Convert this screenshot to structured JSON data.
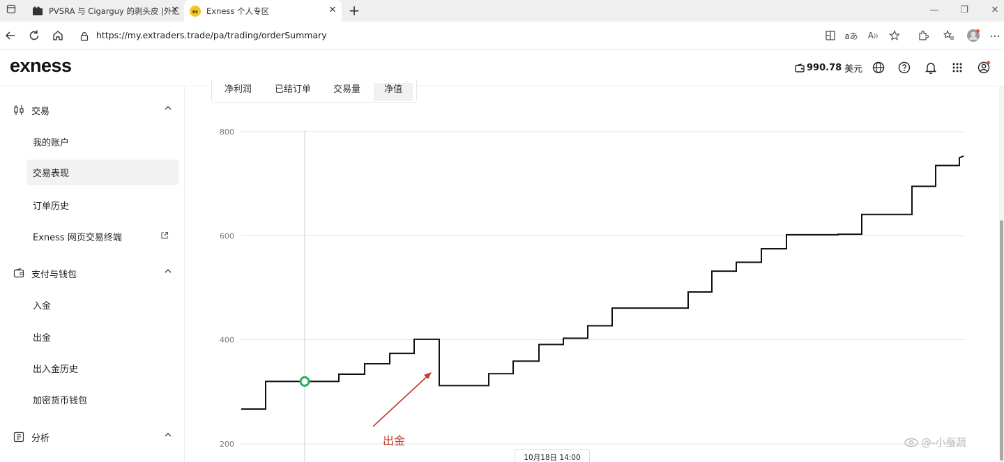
{
  "browser": {
    "tabs": [
      {
        "title": "PVSRA 与 Cigarguy 的剥头皮 |外汇"
      },
      {
        "title": "Exness 个人专区"
      }
    ],
    "url": "https://my.extraders.trade/pa/trading/orderSummary"
  },
  "header": {
    "logo": "exness",
    "balance": "990.78",
    "balance_unit": "美元"
  },
  "sidebar": {
    "sections": [
      {
        "label": "交易",
        "items": [
          "我的账户",
          "交易表现",
          "订单历史",
          "Exness 网页交易终端"
        ]
      },
      {
        "label": "支付与钱包",
        "items": [
          "入金",
          "出金",
          "出入金历史",
          "加密货币钱包"
        ]
      },
      {
        "label": "分析",
        "items": []
      }
    ],
    "active_item": "交易表现"
  },
  "chart_tabs": [
    "净利润",
    "已结订单",
    "交易量",
    "净值"
  ],
  "active_chart_tab": "净值",
  "chart_data": {
    "type": "line",
    "title": "",
    "xlabel": "",
    "ylabel": "",
    "y_ticks": [
      200,
      400,
      600,
      800
    ],
    "ylim": [
      200,
      800
    ],
    "grid": true,
    "step_line": true,
    "line_color": "#111111",
    "marker_color": "#27ae60",
    "points": [
      [
        0,
        267
      ],
      [
        35,
        267
      ],
      [
        35,
        320
      ],
      [
        140,
        320
      ],
      [
        140,
        334
      ],
      [
        177,
        334
      ],
      [
        177,
        354
      ],
      [
        213,
        354
      ],
      [
        213,
        374
      ],
      [
        248,
        374
      ],
      [
        248,
        401
      ],
      [
        284,
        401
      ],
      [
        284,
        312
      ],
      [
        355,
        312
      ],
      [
        355,
        335
      ],
      [
        390,
        335
      ],
      [
        390,
        359
      ],
      [
        427,
        359
      ],
      [
        427,
        391
      ],
      [
        462,
        391
      ],
      [
        462,
        403
      ],
      [
        497,
        403
      ],
      [
        497,
        427
      ],
      [
        532,
        427
      ],
      [
        532,
        461
      ],
      [
        641,
        461
      ],
      [
        641,
        492
      ],
      [
        675,
        492
      ],
      [
        675,
        532
      ],
      [
        710,
        532
      ],
      [
        710,
        549
      ],
      [
        746,
        549
      ],
      [
        746,
        575
      ],
      [
        782,
        575
      ],
      [
        782,
        602
      ],
      [
        856,
        602
      ],
      [
        856,
        603
      ],
      [
        890,
        603
      ],
      [
        890,
        641
      ],
      [
        962,
        641
      ],
      [
        962,
        695
      ],
      [
        996,
        695
      ],
      [
        996,
        735
      ],
      [
        1030,
        735
      ],
      [
        1030,
        750
      ],
      [
        1036,
        753
      ]
    ],
    "hover_point": [
      91,
      320
    ],
    "tooltip_label": "10月18日 14:00",
    "annotation": "出金",
    "annotation_color": "#c0392b"
  },
  "watermark": "@-小蚕蔬"
}
